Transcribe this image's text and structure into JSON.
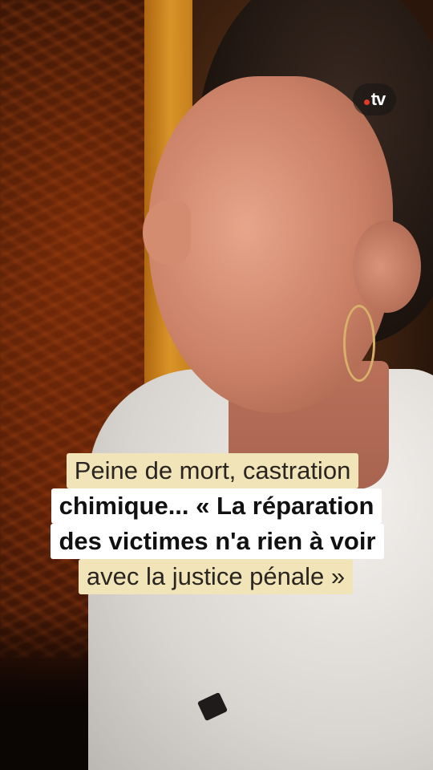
{
  "channel": {
    "logo_text": "tv",
    "logo_dot_color": "#e23a2a"
  },
  "caption": {
    "lines": [
      {
        "text": "Peine de mort, castration",
        "style": "beige"
      },
      {
        "text": "chimique... « La réparation",
        "style": "white-bold"
      },
      {
        "text": "des victimes n'a rien à voir",
        "style": "white-bold"
      },
      {
        "text": "avec la justice pénale »",
        "style": "beige"
      }
    ],
    "colors": {
      "beige": "#f1e4b8",
      "white": "#ffffff"
    }
  }
}
